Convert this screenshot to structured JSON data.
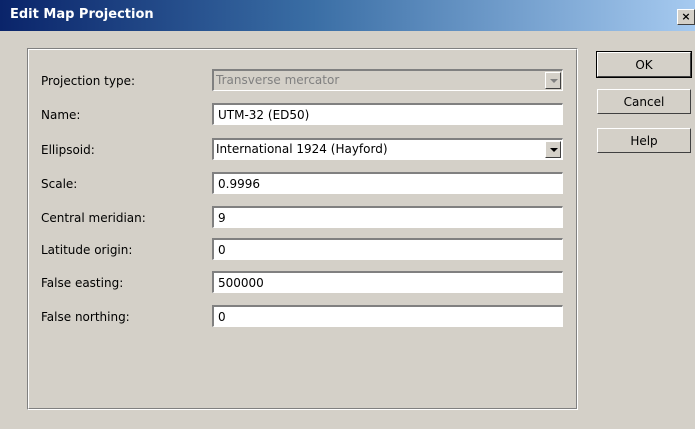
{
  "window": {
    "title": "Edit Map Projection",
    "close_glyph": "×"
  },
  "form": {
    "projection_type": {
      "label": "Projection type:",
      "value": "Transverse mercator"
    },
    "name": {
      "label": "Name:",
      "value": "UTM-32 (ED50)"
    },
    "ellipsoid": {
      "label": "Ellipsoid:",
      "value": "International 1924 (Hayford)"
    },
    "scale": {
      "label": "Scale:",
      "value": "0.9996"
    },
    "central_meridian": {
      "label": "Central meridian:",
      "value": "9"
    },
    "latitude_origin": {
      "label": "Latitude origin:",
      "value": "0"
    },
    "false_easting": {
      "label": "False easting:",
      "value": "500000"
    },
    "false_northing": {
      "label": "False northing:",
      "value": "0"
    }
  },
  "buttons": {
    "ok": "OK",
    "cancel": "Cancel",
    "help": "Help"
  }
}
